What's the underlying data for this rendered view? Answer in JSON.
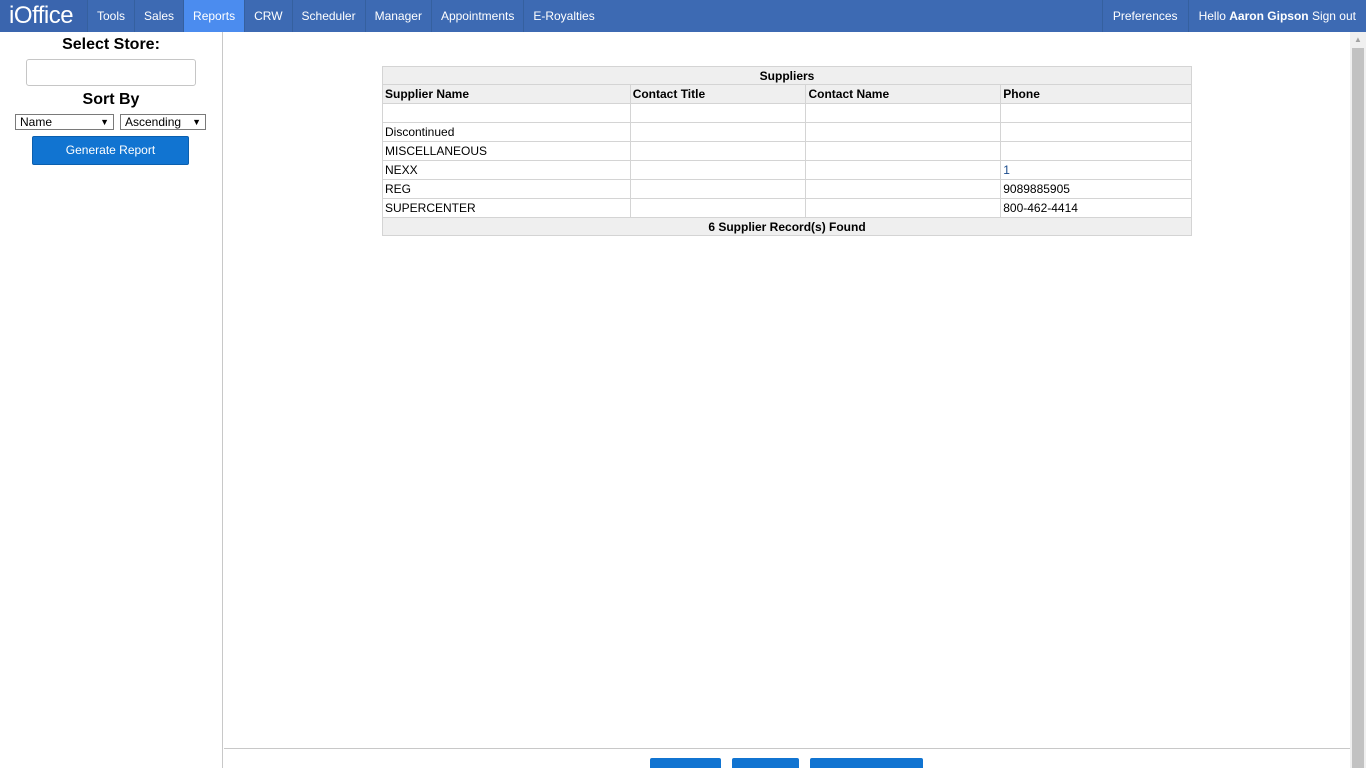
{
  "nav": {
    "logo": "iOffice",
    "items": [
      {
        "label": "Tools"
      },
      {
        "label": "Sales"
      },
      {
        "label": "Reports"
      },
      {
        "label": "CRW"
      },
      {
        "label": "Scheduler"
      },
      {
        "label": "Manager"
      },
      {
        "label": "Appointments"
      },
      {
        "label": "E-Royalties"
      }
    ],
    "active": "Reports",
    "preferences": "Preferences",
    "greeting": "Hello",
    "user_name": "Aaron Gipson",
    "sign_out": "Sign out"
  },
  "sidebar": {
    "select_store_label": "Select Store:",
    "store_value": "",
    "sort_by_label": "Sort By",
    "sort_field": "Name",
    "sort_order": "Ascending",
    "generate_button": "Generate Report"
  },
  "report": {
    "title": "Suppliers",
    "columns": [
      "Supplier Name",
      "Contact Title",
      "Contact Name",
      "Phone"
    ],
    "rows": [
      [
        "",
        "",
        "",
        ""
      ],
      [
        "Discontinued",
        "",
        "",
        ""
      ],
      [
        "MISCELLANEOUS",
        "",
        "",
        ""
      ],
      [
        "NEXX",
        "",
        "",
        "1"
      ],
      [
        "REG",
        "",
        "",
        "9089885905"
      ],
      [
        "SUPERCENTER",
        "",
        "",
        "800-462-4414"
      ]
    ],
    "footer": "6 Supplier Record(s) Found"
  }
}
